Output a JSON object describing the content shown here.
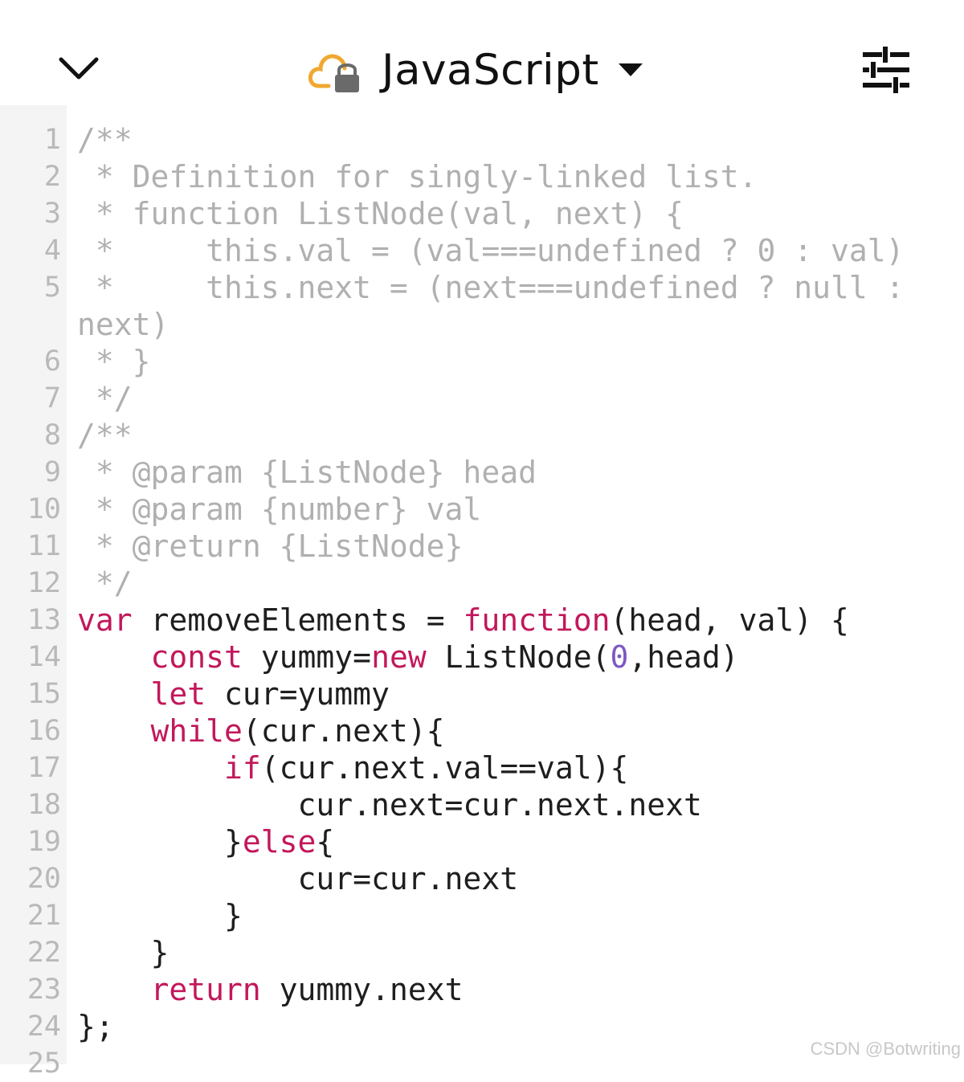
{
  "header": {
    "chevron_icon": "chevron-down-icon",
    "cloud_icon": "cloud-lock-icon",
    "language": "JavaScript",
    "caret_icon": "caret-down-icon",
    "settings_icon": "sliders-icon"
  },
  "colors": {
    "comment": "#b0b0b0",
    "keyword": "#c2185b",
    "number": "#7e57c2",
    "text": "#1e1e1e",
    "line_number": "#b9b9b9",
    "gutter": "#f4f4f4",
    "cloud": "#f0a830",
    "lock": "#6a6a6a"
  },
  "code": {
    "lines": [
      {
        "n": "1",
        "tokens": [
          {
            "t": "/**",
            "c": "c"
          }
        ]
      },
      {
        "n": "2",
        "tokens": [
          {
            "t": " * Definition for singly-linked list.",
            "c": "c"
          }
        ]
      },
      {
        "n": "3",
        "tokens": [
          {
            "t": " * function ListNode(val, next) {",
            "c": "c"
          }
        ]
      },
      {
        "n": "4",
        "tokens": [
          {
            "t": " *     this.val = (val===undefined ? 0 : val)",
            "c": "c"
          }
        ]
      },
      {
        "n": "5",
        "tokens": [
          {
            "t": " *     this.next = (next===undefined ? null :",
            "c": "c"
          }
        ]
      },
      {
        "n": "",
        "tokens": [
          {
            "t": "next)",
            "c": "c"
          }
        ]
      },
      {
        "n": "6",
        "tokens": [
          {
            "t": " * }",
            "c": "c"
          }
        ]
      },
      {
        "n": "7",
        "tokens": [
          {
            "t": " */",
            "c": "c"
          }
        ]
      },
      {
        "n": "8",
        "tokens": [
          {
            "t": "/**",
            "c": "c"
          }
        ]
      },
      {
        "n": "9",
        "tokens": [
          {
            "t": " * @param {ListNode} head",
            "c": "c"
          }
        ]
      },
      {
        "n": "10",
        "tokens": [
          {
            "t": " * @param {number} val",
            "c": "c"
          }
        ]
      },
      {
        "n": "11",
        "tokens": [
          {
            "t": " * @return {ListNode}",
            "c": "c"
          }
        ]
      },
      {
        "n": "12",
        "tokens": [
          {
            "t": " */",
            "c": "c"
          }
        ]
      },
      {
        "n": "13",
        "tokens": [
          {
            "t": "var",
            "c": "k"
          },
          {
            "t": " removeElements = ",
            "c": ""
          },
          {
            "t": "function",
            "c": "k"
          },
          {
            "t": "(head, val) {",
            "c": ""
          }
        ]
      },
      {
        "n": "14",
        "tokens": [
          {
            "t": "    ",
            "c": ""
          },
          {
            "t": "const",
            "c": "k"
          },
          {
            "t": " yummy=",
            "c": ""
          },
          {
            "t": "new",
            "c": "k"
          },
          {
            "t": " ListNode(",
            "c": ""
          },
          {
            "t": "0",
            "c": "n"
          },
          {
            "t": ",head)",
            "c": ""
          }
        ]
      },
      {
        "n": "15",
        "tokens": [
          {
            "t": "    ",
            "c": ""
          },
          {
            "t": "let",
            "c": "k"
          },
          {
            "t": " cur=yummy",
            "c": ""
          }
        ]
      },
      {
        "n": "16",
        "tokens": [
          {
            "t": "    ",
            "c": ""
          },
          {
            "t": "while",
            "c": "k"
          },
          {
            "t": "(cur.next){",
            "c": ""
          }
        ]
      },
      {
        "n": "17",
        "tokens": [
          {
            "t": "        ",
            "c": ""
          },
          {
            "t": "if",
            "c": "k"
          },
          {
            "t": "(cur.next.val==val){",
            "c": ""
          }
        ]
      },
      {
        "n": "18",
        "tokens": [
          {
            "t": "            cur.next=cur.next.next",
            "c": ""
          }
        ]
      },
      {
        "n": "19",
        "tokens": [
          {
            "t": "        }",
            "c": ""
          },
          {
            "t": "else",
            "c": "k"
          },
          {
            "t": "{",
            "c": ""
          }
        ]
      },
      {
        "n": "20",
        "tokens": [
          {
            "t": "            cur=cur.next",
            "c": ""
          }
        ]
      },
      {
        "n": "21",
        "tokens": [
          {
            "t": "        }",
            "c": ""
          }
        ]
      },
      {
        "n": "22",
        "tokens": [
          {
            "t": "    }",
            "c": ""
          }
        ]
      },
      {
        "n": "23",
        "tokens": [
          {
            "t": "    ",
            "c": ""
          },
          {
            "t": "return",
            "c": "k"
          },
          {
            "t": " yummy.next",
            "c": ""
          }
        ]
      },
      {
        "n": "24",
        "tokens": [
          {
            "t": "};",
            "c": ""
          }
        ]
      },
      {
        "n": "25",
        "tokens": []
      }
    ]
  },
  "watermark": "CSDN @Botwriting"
}
